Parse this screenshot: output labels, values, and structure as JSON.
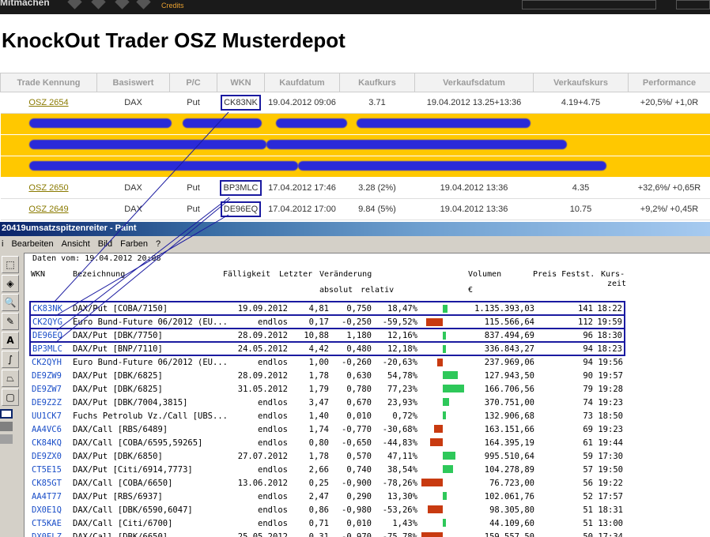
{
  "topbar": {
    "brand": "Mitmachen",
    "credit": "Credits"
  },
  "page": {
    "title": "KnockOut Trader OSZ Musterdepot"
  },
  "trades": {
    "headers": [
      "Trade Kennung",
      "Basiswert",
      "P/C",
      "WKN",
      "Kaufdatum",
      "Kaufkurs",
      "Verkaufsdatum",
      "Verkaufskurs",
      "Performance"
    ],
    "rows": [
      [
        "OSZ 2654",
        "DAX",
        "Put",
        "CK83NK",
        "19.04.2012 09:06",
        "3.71",
        "19.04.2012 13.25+13:36",
        "4.19+4.75",
        "+20,5%/ +1,0R"
      ],
      [
        "OSZ 2650",
        "DAX",
        "Put",
        "BP3MLC",
        "17.04.2012 17:46",
        "3.28 (2%)",
        "19.04.2012 13:36",
        "4.35",
        "+32,6%/ +0,65R"
      ],
      [
        "OSZ 2649",
        "DAX",
        "Put",
        "DE96EQ",
        "17.04.2012 17:00",
        "9.84 (5%)",
        "19.04.2012 13:36",
        "10.75",
        "+9,2%/ +0,45R"
      ]
    ]
  },
  "paint": {
    "title": "20419umsatzspitzenreiter - Paint",
    "menu": [
      "i",
      "Bearbeiten",
      "Ansicht",
      "Bild",
      "Farben",
      "?"
    ],
    "date_line": "Daten vom: 19.04.2012 20:08",
    "col_headers": {
      "wkn": "WKN",
      "bez": "Bezeichnung",
      "fal": "Fälligkeit",
      "let": "Letzter",
      "ver": "Veränderung",
      "abs": "absolut",
      "rel": "relativ",
      "vol": "Volumen",
      "eur": "€",
      "pf": "Preis Festst.",
      "kz1": "Kurs-",
      "kz2": "zeit"
    },
    "rows": [
      [
        "CK83NK",
        "DAX/Put [COBA/7150]",
        "19.09.2012",
        "4,81",
        "0,750",
        "18,47%",
        "1.135.393,03",
        "141",
        "18:22"
      ],
      [
        "CK2QYG",
        "Euro Bund-Future 06/2012 (EU...",
        "endlos",
        "0,17",
        "-0,250",
        "-59,52%",
        "115.566,64",
        "112",
        "19:59"
      ],
      [
        "DE96EQ",
        "DAX/Put [DBK/7750]",
        "28.09.2012",
        "10,88",
        "1,180",
        "12,16%",
        "837.494,69",
        "96",
        "18:30"
      ],
      [
        "BP3MLC",
        "DAX/Put [BNP/7110]",
        "24.05.2012",
        "4,42",
        "0,480",
        "12,18%",
        "336.843,27",
        "94",
        "18:23"
      ],
      [
        "CK2QYH",
        "Euro Bund-Future 06/2012 (EU...",
        "endlos",
        "1,00",
        "-0,260",
        "-20,63%",
        "237.969,06",
        "94",
        "19:56"
      ],
      [
        "DE9ZW9",
        "DAX/Put [DBK/6825]",
        "28.09.2012",
        "1,78",
        "0,630",
        "54,78%",
        "127.943,50",
        "90",
        "19:57"
      ],
      [
        "DE9ZW7",
        "DAX/Put [DBK/6825]",
        "31.05.2012",
        "1,79",
        "0,780",
        "77,23%",
        "166.706,56",
        "79",
        "19:28"
      ],
      [
        "DE9Z2Z",
        "DAX/Put [DBK/7004,3815]",
        "endlos",
        "3,47",
        "0,670",
        "23,93%",
        "370.751,00",
        "74",
        "19:23"
      ],
      [
        "UU1CK7",
        "Fuchs Petrolub Vz./Call [UBS...",
        "endlos",
        "1,40",
        "0,010",
        "0,72%",
        "132.906,68",
        "73",
        "18:50"
      ],
      [
        "AA4VC6",
        "DAX/Call [RBS/6489]",
        "endlos",
        "1,74",
        "-0,770",
        "-30,68%",
        "163.151,66",
        "69",
        "19:23"
      ],
      [
        "CK84KQ",
        "DAX/Call [COBA/6595,59265]",
        "endlos",
        "0,80",
        "-0,650",
        "-44,83%",
        "164.395,19",
        "61",
        "19:44"
      ],
      [
        "DE9ZX0",
        "DAX/Put [DBK/6850]",
        "27.07.2012",
        "1,78",
        "0,570",
        "47,11%",
        "995.510,64",
        "59",
        "17:30"
      ],
      [
        "CT5E15",
        "DAX/Put [Citi/6914,7773]",
        "endlos",
        "2,66",
        "0,740",
        "38,54%",
        "104.278,89",
        "57",
        "19:50"
      ],
      [
        "CK85GT",
        "DAX/Call [COBA/6650]",
        "13.06.2012",
        "0,25",
        "-0,900",
        "-78,26%",
        "76.723,00",
        "56",
        "19:22"
      ],
      [
        "AA4T77",
        "DAX/Put [RBS/6937]",
        "endlos",
        "2,47",
        "0,290",
        "13,30%",
        "102.061,76",
        "52",
        "17:57"
      ],
      [
        "DX0E1Q",
        "DAX/Call [DBK/6590,6047]",
        "endlos",
        "0,86",
        "-0,980",
        "-53,26%",
        "98.305,80",
        "51",
        "18:31"
      ],
      [
        "CT5KAE",
        "DAX/Call [Citi/6700]",
        "endlos",
        "0,71",
        "0,010",
        "1,43%",
        "44.109,60",
        "51",
        "13:00"
      ],
      [
        "DX0ELZ",
        "DAX/Call [DBK/6650]",
        "25.05.2012",
        "0,31",
        "-0,970",
        "-75,78%",
        "159.557,50",
        "50",
        "17:34"
      ]
    ],
    "bar_rel": [
      18.47,
      -59.52,
      12.16,
      12.18,
      -20.63,
      54.78,
      77.23,
      23.93,
      0.72,
      -30.68,
      -44.83,
      47.11,
      38.54,
      -78.26,
      13.3,
      -53.26,
      1.43,
      -75.78
    ],
    "boxed": [
      "CK83NK",
      "CK2QYG",
      "DE96EQ",
      "BP3MLC"
    ]
  },
  "colors": {
    "highlight": "#ffc800",
    "box": "#1a1aa0",
    "pos": "#2ec85a",
    "neg": "#c83a10",
    "link": "#8a7a00"
  }
}
